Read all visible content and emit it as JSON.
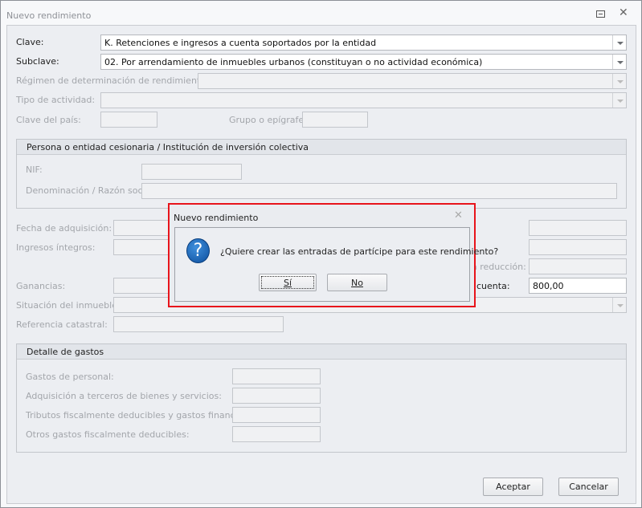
{
  "window": {
    "title": "Nuevo rendimiento",
    "restore_icon": "restore-icon",
    "close_icon": "close-icon"
  },
  "form": {
    "clave": {
      "label": "Clave:",
      "value": "K. Retenciones e ingresos a cuenta soportados por la entidad"
    },
    "subclave": {
      "label": "Subclave:",
      "value": "02. Por arrendamiento de inmuebles urbanos (constituyan o no actividad económica)"
    },
    "regimen": {
      "label": "Régimen de determinación de rendimientos:"
    },
    "tipo_actividad": {
      "label": "Tipo de actividad:"
    },
    "clave_pais": {
      "label": "Clave del país:"
    },
    "grupo_epigrafe": {
      "label": "Grupo o epígrafe:"
    },
    "persona_group": {
      "title": "Persona o entidad cesionaria / Institución de inversión colectiva",
      "nif_label": "NIF:",
      "denominacion_label": "Denominación / Razón social:"
    },
    "fecha_adquisicion": {
      "label": "Fecha de adquisición:"
    },
    "ingresos_integros": {
      "label": "Ingresos íntegros:"
    },
    "reduccion_label": "a reducción:",
    "ganancias": {
      "label": "Ganancias:"
    },
    "cuenta": {
      "label": "cuenta:",
      "value": "800,00"
    },
    "situacion_inmueble": {
      "label": "Situación del inmueble:"
    },
    "referencia_catastral": {
      "label": "Referencia catastral:"
    },
    "gastos_group": {
      "title": "Detalle de gastos",
      "items": [
        "Gastos de personal:",
        "Adquisición a terceros de bienes y servicios:",
        "Tributos fiscalmente deducibles y gastos financieros:",
        "Otros gastos fiscalmente deducibles:"
      ]
    }
  },
  "buttons": {
    "accept": "Aceptar",
    "cancel": "Cancelar"
  },
  "dialog": {
    "title": "Nuevo rendimiento",
    "icon": "question-icon",
    "message": "¿Quiere crear las entradas de partícipe para este rendimiento?",
    "yes": "Sí",
    "no": "No",
    "highlight_color": "#e8141b"
  }
}
